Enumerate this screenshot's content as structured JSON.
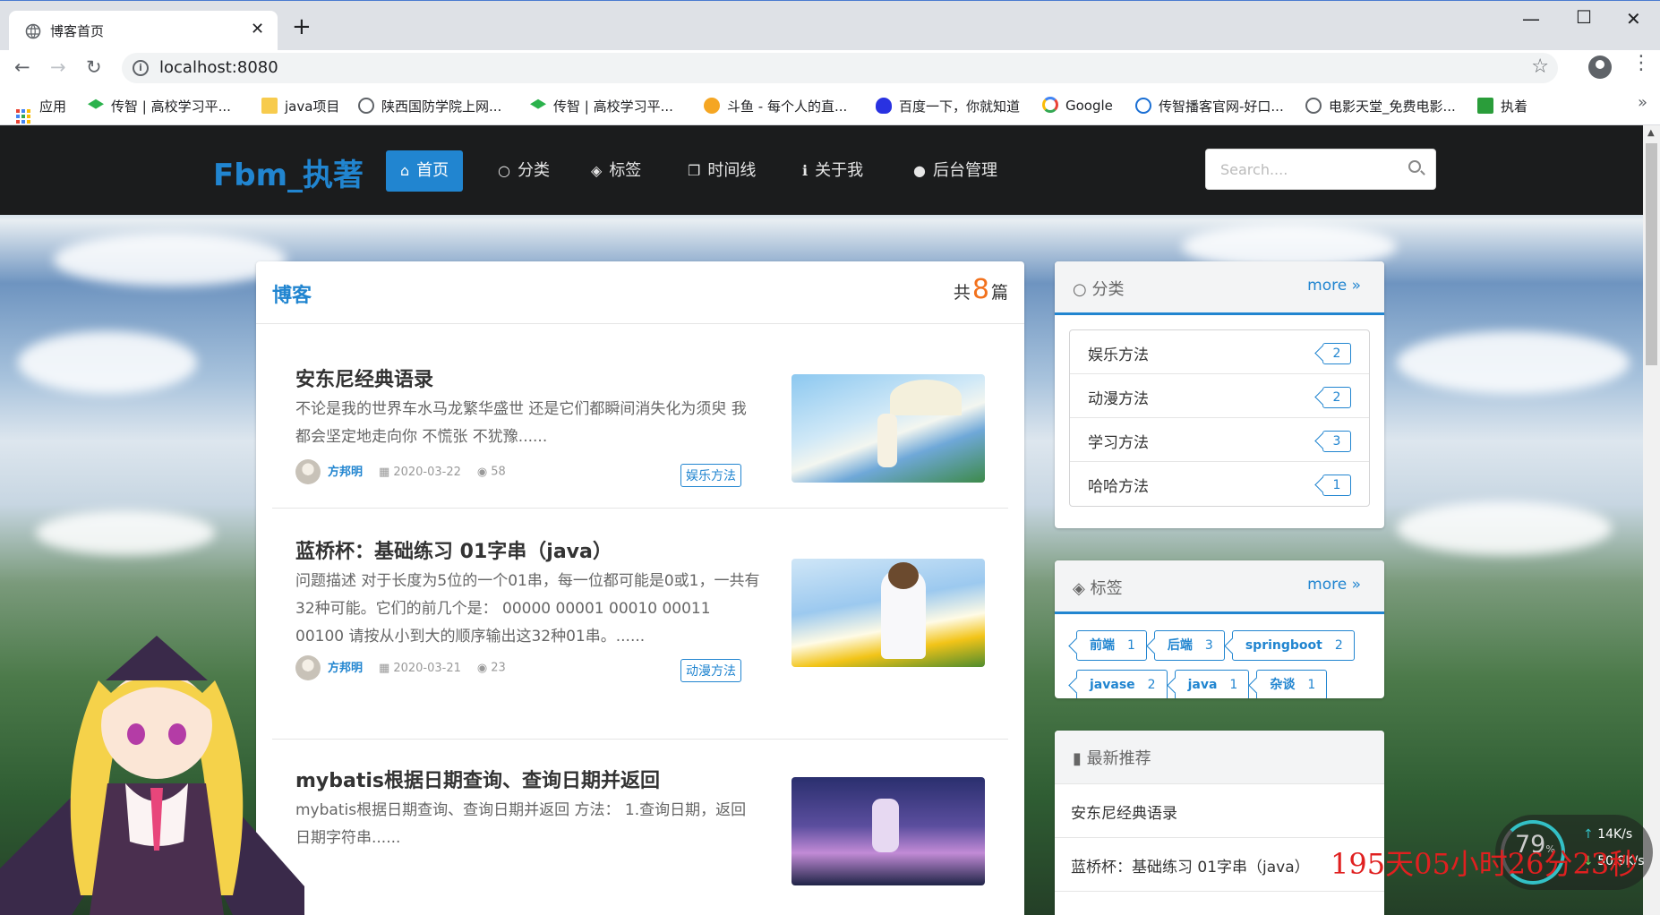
{
  "browser": {
    "tab_title": "博客首页",
    "close_glyph": "✕",
    "newtab_glyph": "+",
    "url": "localhost:8080",
    "bookmarks": [
      {
        "label": "应用",
        "icon": "apps-grid-icon"
      },
      {
        "label": "传智 | 高校学习平...",
        "icon": "graduation-cap-icon"
      },
      {
        "label": "java项目",
        "icon": "folder-icon"
      },
      {
        "label": "陕西国防学院上网...",
        "icon": "globe-icon"
      },
      {
        "label": "传智 | 高校学习平...",
        "icon": "graduation-cap-icon"
      },
      {
        "label": "斗鱼 - 每个人的直...",
        "icon": "douyu-icon"
      },
      {
        "label": "百度一下，你就知道",
        "icon": "baidu-paw-icon"
      },
      {
        "label": "Google",
        "icon": "google-icon"
      },
      {
        "label": "传智播客官网-好口...",
        "icon": "chuanzhi-icon"
      },
      {
        "label": "电影天堂_免费电影...",
        "icon": "globe-icon"
      },
      {
        "label": "执着",
        "icon": "douban-icon"
      }
    ],
    "bookmarks_more": "»"
  },
  "site": {
    "brand": "Fbm_执著",
    "nav": [
      {
        "label": "首页",
        "icon": "home-icon",
        "active": true
      },
      {
        "label": "分类",
        "icon": "lightbulb-icon"
      },
      {
        "label": "标签",
        "icon": "tags-icon"
      },
      {
        "label": "时间线",
        "icon": "clone-icon"
      },
      {
        "label": "关于我",
        "icon": "info-icon"
      },
      {
        "label": "后台管理",
        "icon": "user-icon"
      }
    ],
    "search_placeholder": "Search...."
  },
  "blog": {
    "heading": "博客",
    "count_prefix": "共",
    "count": "8",
    "count_suffix": "篇",
    "posts": [
      {
        "title": "安东尼经典语录",
        "excerpt": "不论是我的世界车水马龙繁华盛世 还是它们都瞬间消失化为须臾 我都会坚定地走向你 不慌张 不犹豫......",
        "author": "方邦明",
        "date": "2020-03-22",
        "views": "58",
        "tag": "娱乐方法"
      },
      {
        "title": "蓝桥杯：基础练习 01字串（java）",
        "excerpt": "问题描述 对于长度为5位的一个01串，每一位都可能是0或1，一共有32种可能。它们的前几个是： 00000 00001 00010 00011 00100 请按从小到大的顺序输出这32种01串。......",
        "author": "方邦明",
        "date": "2020-03-21",
        "views": "23",
        "tag": "动漫方法"
      },
      {
        "title": "mybatis根据日期查询、查询日期并返回",
        "excerpt": "mybatis根据日期查询、查询日期并返回 方法： 1.查询日期，返回日期字符串......"
      }
    ]
  },
  "categories": {
    "title": "分类",
    "more": "more",
    "items": [
      {
        "name": "娱乐方法",
        "count": "2"
      },
      {
        "name": "动漫方法",
        "count": "2"
      },
      {
        "name": "学习方法",
        "count": "3"
      },
      {
        "name": "哈哈方法",
        "count": "1"
      }
    ]
  },
  "tags": {
    "title": "标签",
    "more": "more",
    "items": [
      {
        "name": "前端",
        "count": "1"
      },
      {
        "name": "后端",
        "count": "3"
      },
      {
        "name": "springboot",
        "count": "2"
      },
      {
        "name": "javase",
        "count": "2"
      },
      {
        "name": "java",
        "count": "1"
      },
      {
        "name": "杂谈",
        "count": "1"
      }
    ]
  },
  "recommend": {
    "title": "最新推荐",
    "items": [
      "安东尼经典语录",
      "蓝桥杯：基础练习 01字串（java）"
    ]
  },
  "overlay": {
    "timer": "195天05小时26分23秒",
    "speed_pct": "79",
    "speed_pct_unit": "%",
    "speed_up": "14K/s",
    "speed_down": "50.9K/s"
  },
  "colors": {
    "accent": "#2185d0",
    "nav_bg": "#1b1c1d",
    "count_orange": "#f2711c",
    "timer_red": "#e02020"
  }
}
